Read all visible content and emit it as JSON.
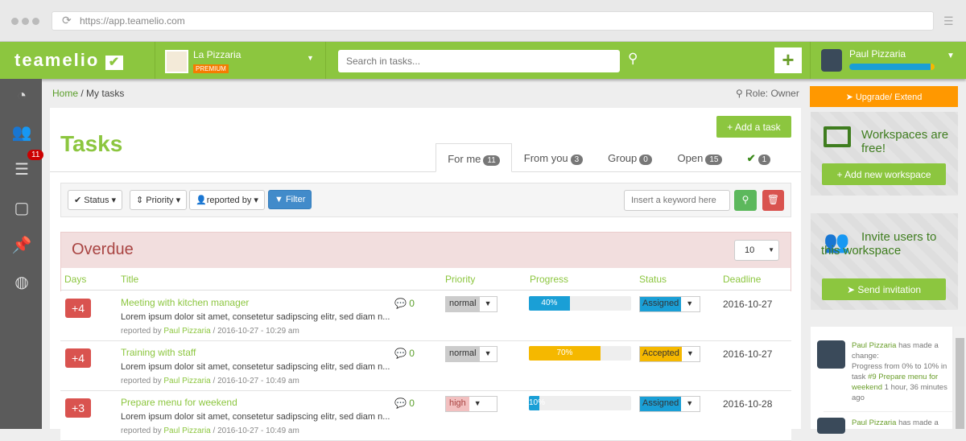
{
  "browser": {
    "url": "https://app.teamelio.com"
  },
  "header": {
    "logo": "teamelio",
    "company": "La Pizzaria",
    "plan": "PREMIUM",
    "search_placeholder": "Search in tasks...",
    "user": "Paul Pizzaria",
    "user_progress": 0.95
  },
  "sidebar": {
    "notification_count": "11"
  },
  "breadcrumb": {
    "home": "Home",
    "sep": " / ",
    "current": "My tasks"
  },
  "role": "Role: Owner",
  "page": {
    "title": "Tasks",
    "add_task": "Add a task"
  },
  "tabs": [
    {
      "label": "For me",
      "count": "11"
    },
    {
      "label": "From you",
      "count": "3"
    },
    {
      "label": "Group",
      "count": "0"
    },
    {
      "label": "Open",
      "count": "15"
    },
    {
      "label": "",
      "count": "1"
    }
  ],
  "filters": {
    "status": "Status",
    "priority": "Priority",
    "reported_by": "reported by",
    "filter": "Filter",
    "keyword_placeholder": "Insert a keyword here"
  },
  "section": {
    "title": "Overdue",
    "page_size": "10"
  },
  "columns": [
    "Days",
    "Title",
    "Priority",
    "Progress",
    "Status",
    "Deadline"
  ],
  "tasks": [
    {
      "days": "+4",
      "title": "Meeting with kitchen manager",
      "desc": "Lorem ipsum dolor sit amet, consetetur sadipscing elitr, sed diam n...",
      "reported_prefix": "reported by ",
      "reporter": "Paul Pizzaria",
      "reported_at": " / 2016-10-27 - 10:29 am",
      "comments": "0",
      "priority": "normal",
      "progress": "40%",
      "progress_value": 40,
      "progress_color": "#1a9fd6",
      "status": "Assigned",
      "status_color": "#1a9fd6",
      "deadline": "2016-10-27"
    },
    {
      "days": "+4",
      "title": "Training with staff",
      "desc": "Lorem ipsum dolor sit amet, consetetur sadipscing elitr, sed diam n...",
      "reported_prefix": "reported by ",
      "reporter": "Paul Pizzaria",
      "reported_at": " / 2016-10-27 - 10:49 am",
      "comments": "0",
      "priority": "normal",
      "progress": "70%",
      "progress_value": 70,
      "progress_color": "#f5b800",
      "status": "Accepted",
      "status_color": "#f5b800",
      "deadline": "2016-10-27"
    },
    {
      "days": "+3",
      "title": "Prepare menu for weekend",
      "desc": "Lorem ipsum dolor sit amet, consetetur sadipscing elitr, sed diam n...",
      "reported_prefix": "reported by ",
      "reporter": "Paul Pizzaria",
      "reported_at": " / 2016-10-27 - 10:49 am",
      "comments": "0",
      "priority": "high",
      "progress": "10%",
      "progress_value": 10,
      "progress_color": "#1a9fd6",
      "status": "Assigned",
      "status_color": "#1a9fd6",
      "deadline": "2016-10-28"
    }
  ],
  "right": {
    "upgrade": "Upgrade/ Extend",
    "workspaces_free": "Workspaces are free!",
    "add_workspace": "Add new workspace",
    "invite": "Invite users to this workspace",
    "send_invitation": "Send invitation",
    "activity": {
      "user": "Paul Pizzaria",
      "action": " has made a change:",
      "change": "Progress from 0% to 10%",
      "in_task": " in task ",
      "task": "#9 Prepare menu for weekend",
      "time": " 1 hour, 36 minutes ago"
    },
    "activity2": {
      "user": "Paul Pizzaria",
      "action": " has made a"
    }
  }
}
